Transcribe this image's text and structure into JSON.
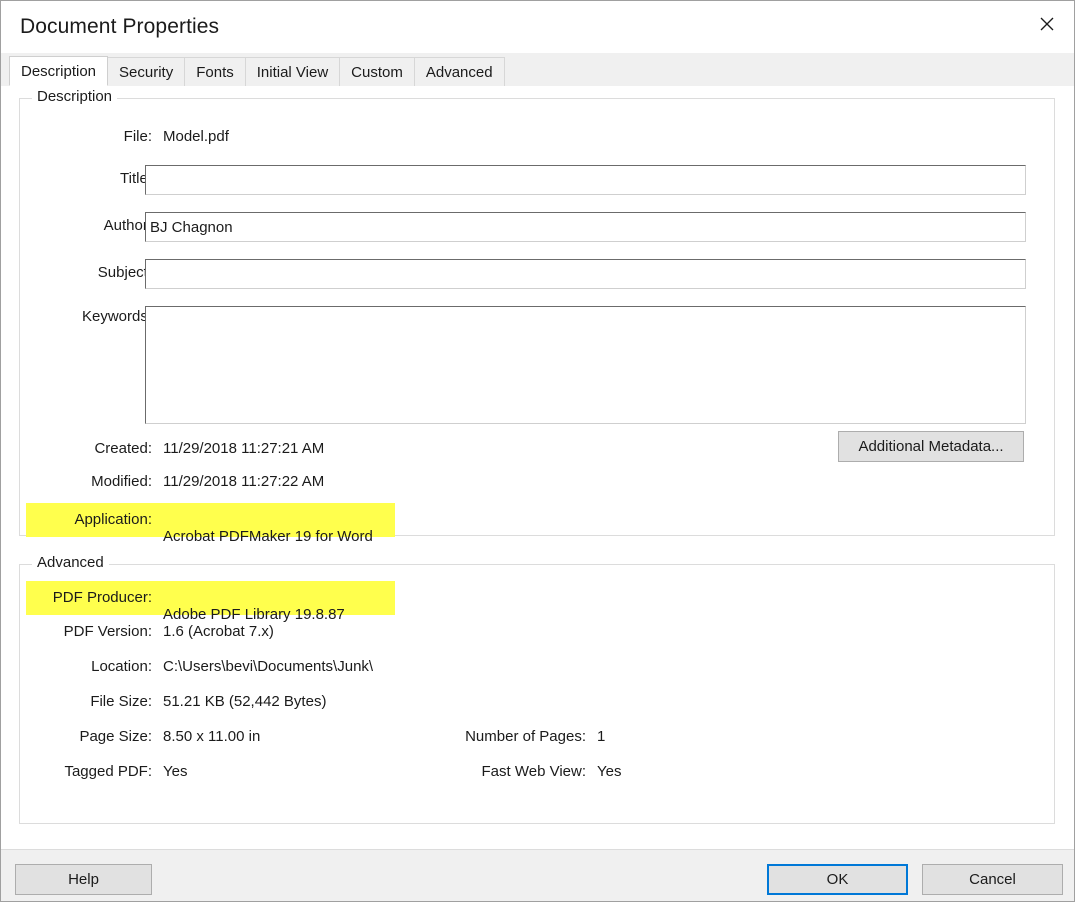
{
  "window": {
    "title": "Document Properties",
    "close_icon": "close-icon"
  },
  "tabs": [
    {
      "label": "Description",
      "active": true,
      "highlighted": true
    },
    {
      "label": "Security",
      "active": false,
      "highlighted": false
    },
    {
      "label": "Fonts",
      "active": false,
      "highlighted": false
    },
    {
      "label": "Initial View",
      "active": false,
      "highlighted": false
    },
    {
      "label": "Custom",
      "active": false,
      "highlighted": false
    },
    {
      "label": "Advanced",
      "active": false,
      "highlighted": false
    }
  ],
  "description_group": {
    "legend": "Description",
    "file": {
      "label": "File:",
      "value": "Model.pdf"
    },
    "title": {
      "label": "Title:",
      "value": "",
      "placeholder": ""
    },
    "author": {
      "label": "Author:",
      "value": "BJ Chagnon",
      "placeholder": ""
    },
    "subject": {
      "label": "Subject:",
      "value": "",
      "placeholder": ""
    },
    "keywords": {
      "label": "Keywords:",
      "value": "",
      "placeholder": ""
    },
    "created": {
      "label": "Created:",
      "value": "11/29/2018 11:27:21 AM"
    },
    "modified": {
      "label": "Modified:",
      "value": "11/29/2018 11:27:22 AM"
    },
    "application": {
      "label": "Application:",
      "value": "Acrobat PDFMaker 19 for Word",
      "highlighted": true
    },
    "additional_metadata_button": "Additional Metadata..."
  },
  "advanced_group": {
    "legend": "Advanced",
    "pdf_producer": {
      "label": "PDF Producer:",
      "value": "Adobe PDF Library 19.8.87",
      "highlighted": true
    },
    "pdf_version": {
      "label": "PDF Version:",
      "value": "1.6 (Acrobat 7.x)"
    },
    "location": {
      "label": "Location:",
      "value": "C:\\Users\\bevi\\Documents\\Junk\\"
    },
    "file_size": {
      "label": "File Size:",
      "value": "51.21 KB (52,442 Bytes)"
    },
    "page_size": {
      "label": "Page Size:",
      "value": "8.50 x 11.00 in"
    },
    "number_of_pages": {
      "label": "Number of Pages:",
      "value": "1"
    },
    "tagged_pdf": {
      "label": "Tagged PDF:",
      "value": "Yes"
    },
    "fast_web_view": {
      "label": "Fast Web View:",
      "value": "Yes"
    }
  },
  "footer": {
    "help_label": "Help",
    "ok_label": "OK",
    "cancel_label": "Cancel"
  },
  "colors": {
    "highlight": "#ffff4d",
    "focus_border": "#0078d7",
    "tab_strip_bg": "#f0f0f0",
    "button_bg": "#e1e1e1"
  }
}
